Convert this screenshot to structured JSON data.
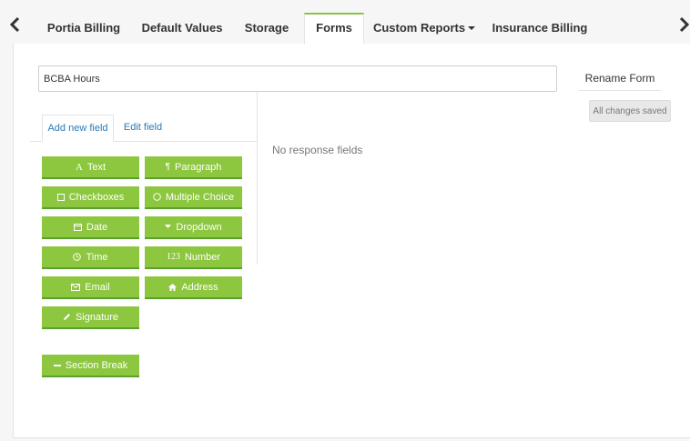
{
  "tabs": [
    {
      "label": "Portia Billing"
    },
    {
      "label": "Default Values"
    },
    {
      "label": "Storage"
    },
    {
      "label": "Forms"
    },
    {
      "label": "Custom Reports"
    },
    {
      "label": "Insurance Billing"
    }
  ],
  "active_tab": "Forms",
  "form": {
    "name_value": "BCBA Hours",
    "rename_label": "Rename Form",
    "status_label": "All changes saved"
  },
  "subtabs": {
    "add": "Add new field",
    "edit": "Edit field"
  },
  "empty_message": "No response fields",
  "field_buttons": {
    "text": "Text",
    "paragraph": "Paragraph",
    "checkboxes": "Checkboxes",
    "multiple_choice": "Multiple Choice",
    "date": "Date",
    "dropdown": "Dropdown",
    "time": "Time",
    "number": "Number",
    "number_icon_text": "123",
    "email": "Email",
    "address": "Address",
    "signature": "Signature",
    "section_break": "Section Break"
  },
  "colors": {
    "accent_green": "#8dc63f",
    "link_blue": "#2a7ab8"
  }
}
